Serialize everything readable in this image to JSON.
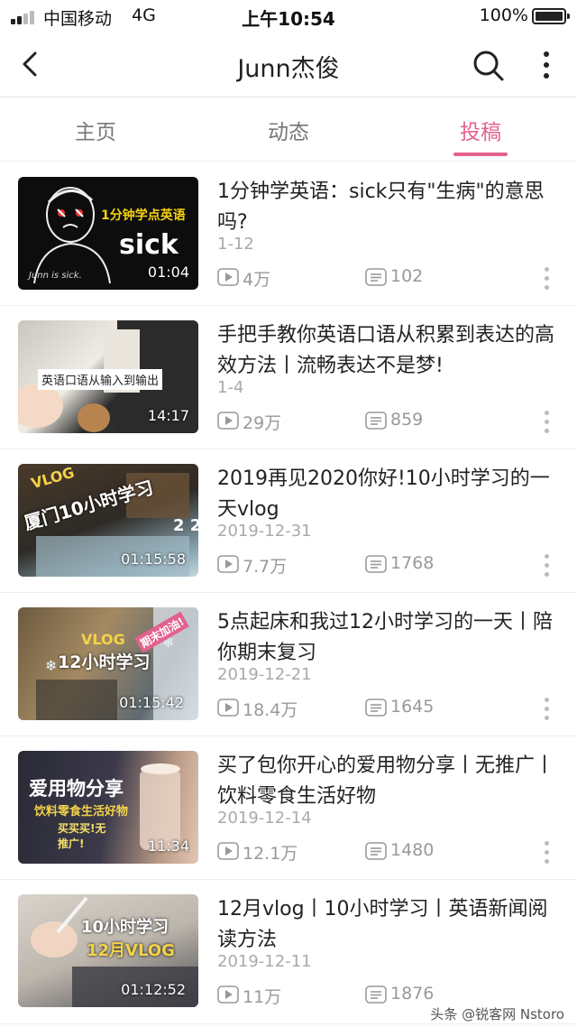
{
  "status_bar": {
    "carrier": "中国移动",
    "network": "4G",
    "time": "上午10:54",
    "battery": "100%"
  },
  "nav": {
    "title": "Junn杰俊",
    "back_icon": "chevron-left-icon",
    "search_icon": "search-icon",
    "more_icon": "more-vertical-icon"
  },
  "tabs": [
    {
      "label": "主页",
      "active": false
    },
    {
      "label": "动态",
      "active": false
    },
    {
      "label": "投稿",
      "active": true
    }
  ],
  "accent_color": "#e3618f",
  "videos": [
    {
      "title": "1分钟学英语：sick只有\"生病\"的意思吗?",
      "date": "1-12",
      "plays": "4万",
      "danmaku": "102",
      "duration": "01:04",
      "thumb_caption": "1分钟学点英语",
      "thumb_big": "sick",
      "thumb_small": "Junn is sick."
    },
    {
      "title": "手把手教你英语口语从积累到表达的高效方法丨流畅表达不是梦!",
      "date": "1-4",
      "plays": "29万",
      "danmaku": "859",
      "duration": "14:17",
      "thumb_caption": "英语口语从输入到输出"
    },
    {
      "title": "2019再见2020你好!10小时学习的一天vlog",
      "date": "2019-12-31",
      "plays": "7.7万",
      "danmaku": "1768",
      "duration": "01:15:58",
      "thumb_caption": "VLOG",
      "thumb_big": "厦门10小时学习",
      "thumb_small": "2 2"
    },
    {
      "title": "5点起床和我过12小时学习的一天丨陪你期末复习",
      "date": "2019-12-21",
      "plays": "18.4万",
      "danmaku": "1645",
      "duration": "01:15:42",
      "thumb_caption": "VLOG",
      "thumb_big": "12小时学习",
      "thumb_small": "期末加油!"
    },
    {
      "title": "买了包你开心的爱用物分享丨无推广丨饮料零食生活好物",
      "date": "2019-12-14",
      "plays": "12.1万",
      "danmaku": "1480",
      "duration": "11:34",
      "thumb_caption": "爱用物分享",
      "thumb_big": "饮料零食生活好物",
      "thumb_small": "买买买!无推广!"
    },
    {
      "title": "12月vlog丨10小时学习丨英语新闻阅读方法",
      "date": "2019-12-11",
      "plays": "11万",
      "danmaku": "1876",
      "duration": "01:12:52",
      "thumb_caption": "10小时学习",
      "thumb_big": "12月VLOG"
    }
  ],
  "watermark": "头条 @锐客网 Nstoro"
}
